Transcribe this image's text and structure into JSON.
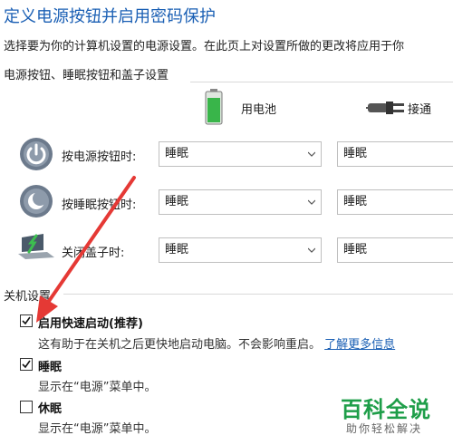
{
  "page": {
    "title": "定义电源按钮并启用密码保护",
    "description": "选择要为你的计算机设置的电源设置。在此页上对设置所做的更改将应用于你"
  },
  "power_section": {
    "title": "电源按钮、睡眠按钮和盖子设置",
    "columns": {
      "battery": "用电池",
      "plugged": "接通"
    },
    "rows": [
      {
        "label": "按电源按钮时:",
        "battery_value": "睡眠",
        "plugged_value": "睡眠",
        "icon": "power-button-icon"
      },
      {
        "label": "按睡眠按钮时:",
        "battery_value": "睡眠",
        "plugged_value": "睡眠",
        "icon": "sleep-button-icon"
      },
      {
        "label": "关闭盖子时:",
        "battery_value": "睡眠",
        "plugged_value": "睡眠",
        "icon": "laptop-lid-icon"
      }
    ]
  },
  "shutdown_section": {
    "title": "关机设置",
    "options": [
      {
        "label": "启用快速启动(推荐)",
        "desc": "这有助于在关机之后更快地启动电脑。不会影响重启。",
        "link": "了解更多信息",
        "checked": true
      },
      {
        "label": "睡眠",
        "desc": "显示在“电源”菜单中。",
        "checked": true
      },
      {
        "label": "休眠",
        "desc": "显示在“电源”菜单中。",
        "checked": false
      }
    ]
  },
  "watermark": {
    "main": "百科全说",
    "sub": "助你轻松解决"
  },
  "colors": {
    "accent": "#1a5fb4",
    "arrow": "#e53935",
    "watermark": "#1e9e49"
  }
}
